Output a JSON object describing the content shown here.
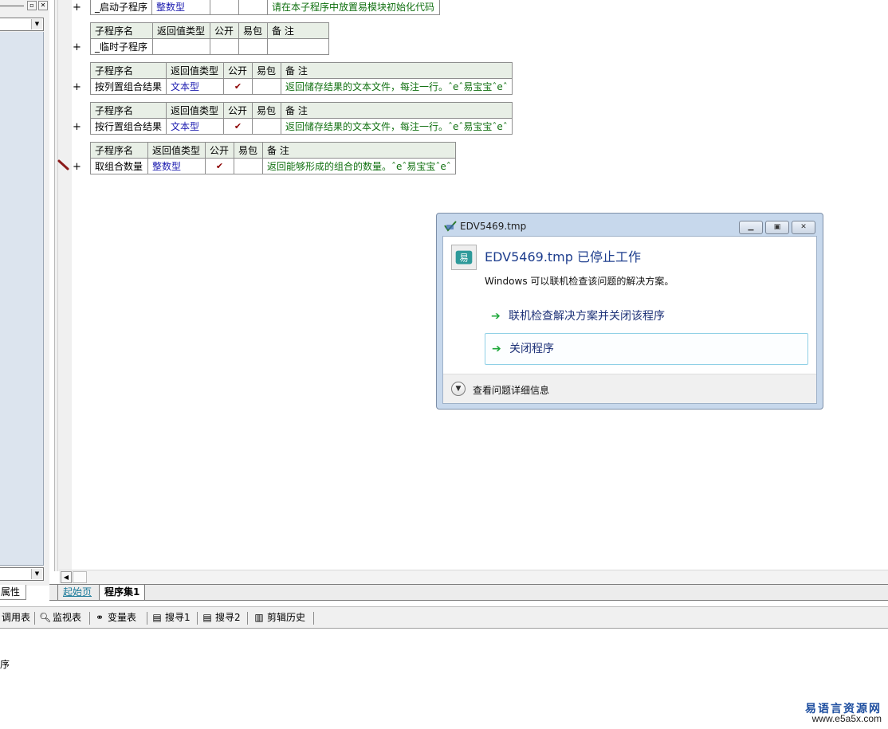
{
  "left_panel": {
    "properties_tab": "属性"
  },
  "editor": {
    "subroutines": [
      {
        "cells": [
          "_启动子程序",
          "整数型",
          "",
          "",
          "请在本子程序中放置易模块初始化代码"
        ],
        "has_header": false
      },
      {
        "headers": [
          "子程序名",
          "返回值类型",
          "公开",
          "易包",
          "备 注"
        ],
        "cells": [
          "_临时子程序",
          "",
          "",
          "",
          ""
        ]
      },
      {
        "headers": [
          "子程序名",
          "返回值类型",
          "公开",
          "易包",
          "备 注"
        ],
        "cells": [
          "按列置组合结果",
          "文本型",
          "✔",
          "",
          "返回储存结果的文本文件，每注一行。ˆeˆ易宝宝ˆeˆ"
        ]
      },
      {
        "headers": [
          "子程序名",
          "返回值类型",
          "公开",
          "易包",
          "备 注"
        ],
        "cells": [
          "按行置组合结果",
          "文本型",
          "✔",
          "",
          "返回储存结果的文本文件，每注一行。ˆeˆ易宝宝ˆeˆ"
        ]
      },
      {
        "headers": [
          "子程序名",
          "返回值类型",
          "公开",
          "易包",
          "备 注"
        ],
        "cells": [
          "取组合数量",
          "整数型",
          "✔",
          "",
          "返回能够形成的组合的数量。ˆeˆ易宝宝ˆeˆ"
        ]
      }
    ],
    "expand_symbol": "+",
    "tabs": [
      "起始页",
      "程序集1"
    ]
  },
  "toolbar": {
    "items": [
      {
        "label": "调用表",
        "icon": ""
      },
      {
        "label": "监视表",
        "icon": "magnifier-icon"
      },
      {
        "label": "变量表",
        "icon": "variable-icon"
      },
      {
        "label": "搜寻1",
        "icon": "search-document-icon"
      },
      {
        "label": "搜寻2",
        "icon": "search-document-icon"
      },
      {
        "label": "剪辑历史",
        "icon": "clipboard-icon"
      }
    ]
  },
  "output": {
    "text": "序"
  },
  "dialog": {
    "title": "EDV5469.tmp",
    "heading": "EDV5469.tmp 已停止工作",
    "description": "Windows 可以联机检查该问题的解决方案。",
    "option_online": "联机检查解决方案并关闭该程序",
    "option_close": "关闭程序",
    "details": "查看问题详细信息"
  },
  "watermark": {
    "name": "易语言资源网",
    "url": "www.e5a5x.com"
  },
  "colors": {
    "table_header_bg": "#e8efe6",
    "type_text": "#1c1cb0",
    "comment_text": "#107010",
    "check_mark": "#8b0000",
    "dialog_frame": "#c7d8ec",
    "dialog_heading": "#1e3e8e"
  }
}
